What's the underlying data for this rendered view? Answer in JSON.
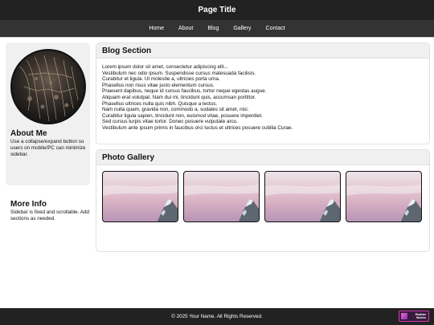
{
  "header": {
    "title": "Page Title"
  },
  "nav": {
    "items": [
      "Home",
      "About",
      "Blog",
      "Gallery",
      "Contact"
    ]
  },
  "sidebar": {
    "about_title": "About Me",
    "about_text": "Use a collapse/expand button so users on mobile/PC can minimize sidebar.",
    "more_title": "More Info",
    "more_text": "Sidebar is fixed and scrollable. Add sections as needed."
  },
  "blog": {
    "title": "Blog Section",
    "lines": [
      "Lorem ipsum dolor sit amet, consectetur adipiscing elit...",
      "Vestibulum nec odio ipsum. Suspendisse cursus malesuada facilisis.",
      "Curabitur et ligula. Ut molestie a, ultricies porta urna.",
      "Phasellus non risus vitae justo elementum cursus.",
      "Praesent dapibus, neque id cursus faucibus, tortor neque egestas augue.",
      "Aliquam erat volutpat. Nam dui mi, tincidunt quis, accumsan porttitor.",
      "Phasellus ultrices nulla quis nibh. Quisque a lectus.",
      "Nam nulla quam, gravida non, commodo a, sodales sit amet, nisi.",
      "Curabitur ligula sapien, tincidunt non, euismod vitae, posuere imperdiet.",
      "Sed cursus turpis vitae tortor. Donec posuere vulputate arcu.",
      "Vestibulum ante ipsum primis in faucibus orci luctus et ultrices posuere cubilia Curae."
    ]
  },
  "gallery": {
    "title": "Photo Gallery",
    "photo_count": 4
  },
  "footer": {
    "text": "© 2025 Your Name. All Rights Reserved."
  },
  "badge": {
    "line1": "Radian",
    "line2": "Works"
  }
}
